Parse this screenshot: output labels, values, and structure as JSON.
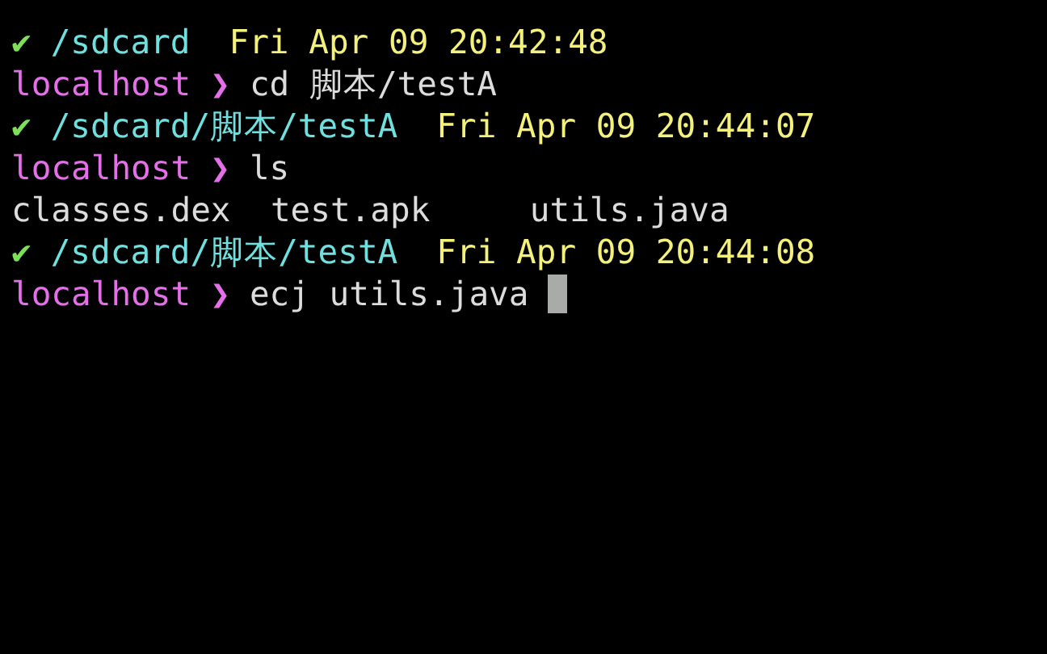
{
  "lines": [
    {
      "kind": "status",
      "mark": "✔",
      "path": "/sdcard",
      "time": "Fri Apr 09 20:42:48"
    },
    {
      "kind": "prompt",
      "host": "localhost",
      "arrow": "❯",
      "command": "cd 脚本/testA",
      "cursor": false
    },
    {
      "kind": "status",
      "mark": "✔",
      "path": "/sdcard/脚本/testA",
      "time": "Fri Apr 09 20:44:07"
    },
    {
      "kind": "prompt",
      "host": "localhost",
      "arrow": "❯",
      "command": "ls",
      "cursor": false
    },
    {
      "kind": "output",
      "text": "classes.dex  test.apk     utils.java"
    },
    {
      "kind": "status",
      "mark": "✔",
      "path": "/sdcard/脚本/testA",
      "time": "Fri Apr 09 20:44:08"
    },
    {
      "kind": "prompt",
      "host": "localhost",
      "arrow": "❯",
      "command": "ecj utils.java",
      "cursor": true
    }
  ]
}
